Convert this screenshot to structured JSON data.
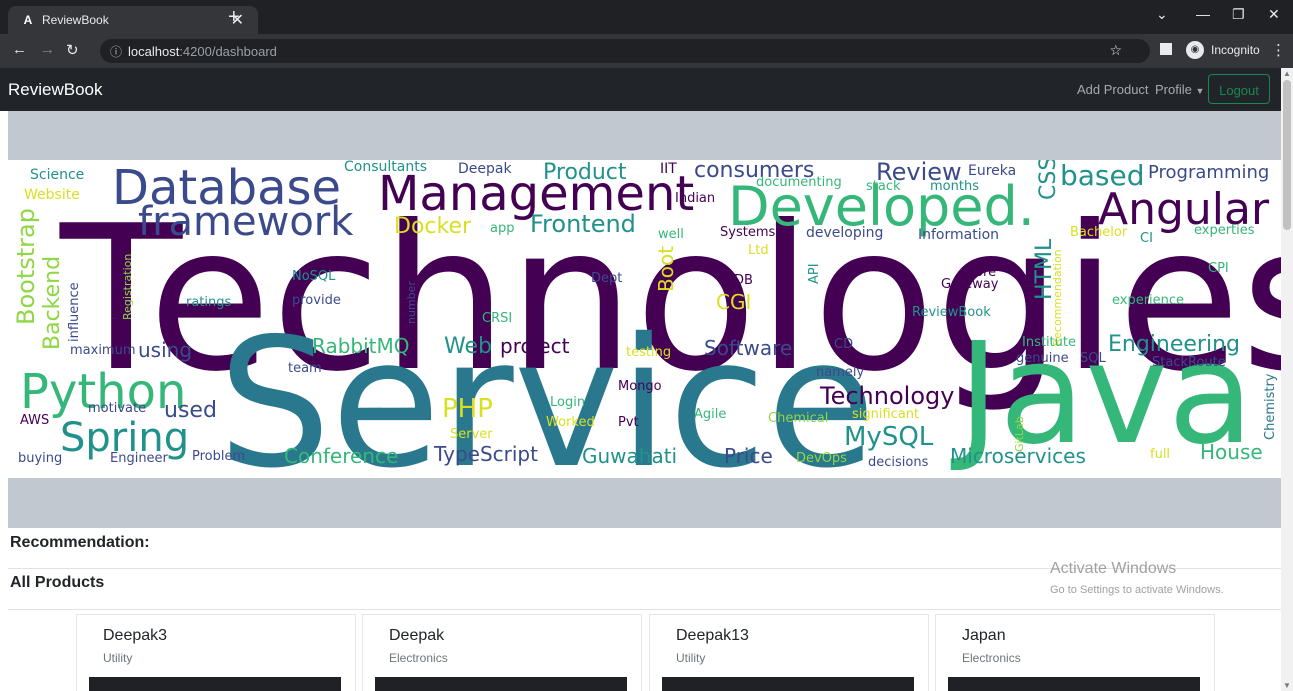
{
  "browser": {
    "tab_title": "ReviewBook",
    "tab_favicon": "A",
    "url_host": "localhost",
    "url_path": ":4200/dashboard",
    "incognito_label": "Incognito"
  },
  "navbar": {
    "brand": "ReviewBook",
    "add_product": "Add Product",
    "profile": "Profile",
    "logout": "Logout"
  },
  "wordcloud_words": [
    "Technologies",
    "Service",
    "Java",
    "Developed.",
    "Management",
    "Database",
    "Angular",
    "framework",
    "Python",
    "Spring",
    "Bootstrap",
    "Backend",
    "Science",
    "Website",
    "Consultants",
    "Deepak",
    "Product",
    "IIT",
    "consumers",
    "Review",
    "Eureka",
    "CSS",
    "based",
    "Programming",
    "documenting",
    "stack",
    "months",
    "Docker",
    "app",
    "Frontend",
    "Indian",
    "well",
    "Systems",
    "developing",
    "Information",
    "HTML",
    "Recommendation",
    "Bachelor",
    "CI",
    "experties",
    "Registration",
    "influence",
    "NoSQL",
    "ratings",
    "provide",
    "number",
    "Dept",
    "Boot",
    "Ltd",
    "DB",
    "API",
    "Core",
    "Gateway",
    "CPI",
    "CGI",
    "CRSI",
    "ReviewBook",
    "experience",
    "maximum",
    "using",
    "RabbitMQ",
    "Web",
    "project",
    "testing",
    "Software",
    "CD",
    "Institute",
    "genuine",
    "SQL",
    "Engineering",
    "team",
    "namely",
    "StackRoute",
    "Mongo",
    "Technology",
    "Chemistry",
    "AWS",
    "motivate",
    "used",
    "PHP",
    "Login",
    "Server",
    "Worked",
    "Pvt",
    "Agile",
    "Chemical",
    "significant",
    "GitLab",
    "MySQL",
    "buying",
    "Engineer",
    "Problem",
    "Conference",
    "TypeScript",
    "Guwahati",
    "Price",
    "DevOps",
    "decisions",
    "Microservices",
    "full",
    "House"
  ],
  "sections": {
    "recommendation": "Recommendation:",
    "all_products": "All Products"
  },
  "products": [
    {
      "name": "Deepak3",
      "category": "Utility"
    },
    {
      "name": "Deepak",
      "category": "Electronics"
    },
    {
      "name": "Deepak13",
      "category": "Utility"
    },
    {
      "name": "Japan",
      "category": "Electronics"
    }
  ],
  "watermark": {
    "title": "Activate Windows",
    "subtitle": "Go to Settings to activate Windows."
  },
  "colors": {
    "navbar_bg": "#212529",
    "banner_bg": "#c2c8cf",
    "logout_accent": "#198754",
    "word_purple": "#440154",
    "word_indigo": "#3b4a8b",
    "word_blue": "#2a788e",
    "word_teal": "#21918c",
    "word_green": "#35b779",
    "word_lime": "#8fd744",
    "word_yellow": "#d9e021"
  }
}
